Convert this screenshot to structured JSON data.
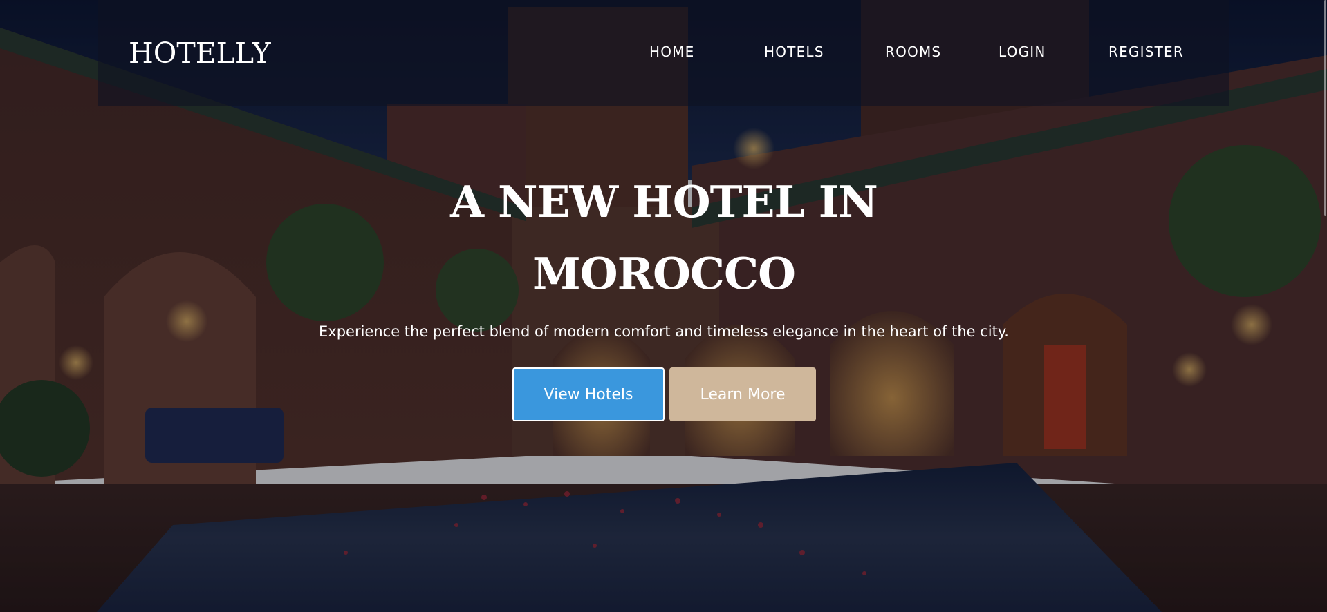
{
  "brand": {
    "logo": "HOTELLY"
  },
  "nav": {
    "items": [
      {
        "label": "HOME"
      },
      {
        "label": "HOTELS"
      },
      {
        "label": "ROOMS"
      },
      {
        "label": "LOGIN"
      },
      {
        "label": "REGISTER"
      }
    ]
  },
  "hero": {
    "title": "A NEW HOTEL IN MOROCCO",
    "subtitle": "Experience the perfect blend of modern comfort and timeless elegance in the heart of the city.",
    "primary_button": "View Hotels",
    "secondary_button": "Learn More"
  },
  "colors": {
    "primary_button_bg": "#3a97dd",
    "secondary_button_bg": "#cfb79b",
    "nav_bg": "#0f1222",
    "text": "#ffffff"
  }
}
